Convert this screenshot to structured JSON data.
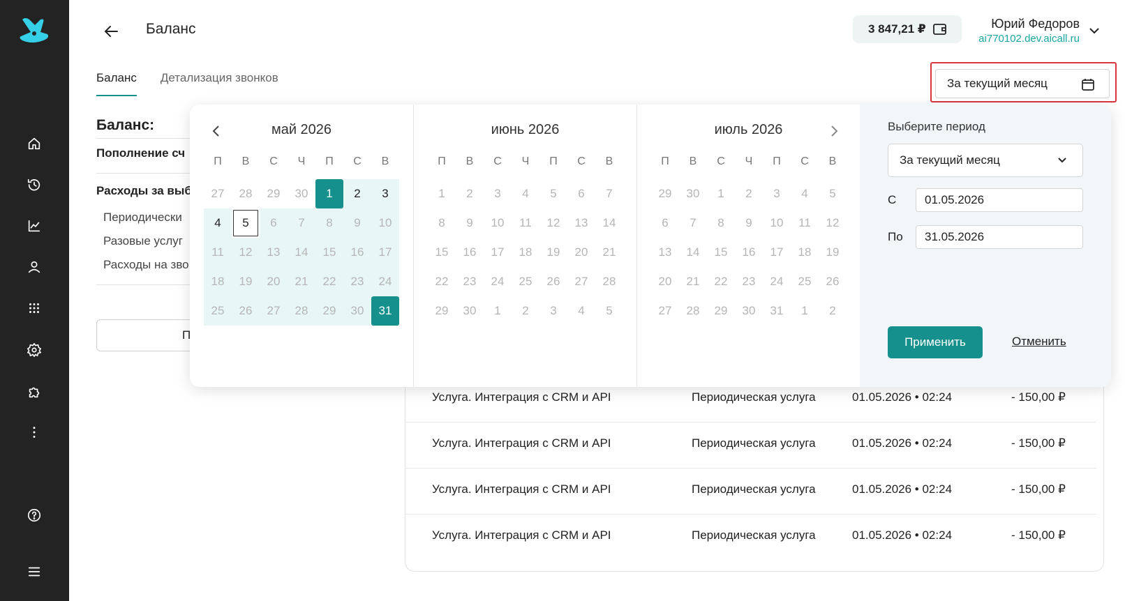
{
  "header": {
    "title": "Баланс",
    "balance": "3 847,21 ₽",
    "user_name": "Юрий Федоров",
    "user_domain": "ai770102.dev.aicall.ru"
  },
  "tabs": [
    {
      "label": "Баланс",
      "active": true
    },
    {
      "label": "Детализация звонков",
      "active": false
    }
  ],
  "period_button": {
    "label": "За текущий месяц"
  },
  "sidebar": {
    "icons": [
      "home-icon",
      "history-icon",
      "analytics-icon",
      "user-icon",
      "dialpad-icon",
      "settings-icon",
      "puzzle-icon",
      "more-icon",
      "help-icon",
      "menu-icon"
    ]
  },
  "left": {
    "title": "Баланс:",
    "topup": "Пополнение сч",
    "expenses": "Расходы за выб",
    "periodic": "Периодически",
    "onetime": "Разовые услуг",
    "calls": "Расходы на зво",
    "button": "П"
  },
  "table": {
    "rows": [
      {
        "service": "Услуга. Интеграция с CRM и API",
        "type": "Периодическая услуга",
        "date": "01.05.2026 • 02:24",
        "amount": "- 150,00 ₽"
      },
      {
        "service": "Услуга. Интеграция с CRM и API",
        "type": "Периодическая услуга",
        "date": "01.05.2026 • 02:24",
        "amount": "- 150,00 ₽"
      },
      {
        "service": "Услуга. Интеграция с CRM и API",
        "type": "Периодическая услуга",
        "date": "01.05.2026 • 02:24",
        "amount": "- 150,00 ₽"
      },
      {
        "service": "Услуга. Интеграция с CRM и API",
        "type": "Периодическая услуга",
        "date": "01.05.2026 • 02:24",
        "amount": "- 150,00 ₽"
      }
    ]
  },
  "calendar": {
    "weekdays": [
      "П",
      "В",
      "С",
      "Ч",
      "П",
      "С",
      "В"
    ],
    "months": [
      {
        "title": "май 2026",
        "first_cur_index": 4,
        "days": [
          27,
          28,
          29,
          30,
          1,
          2,
          3,
          4,
          5,
          6,
          7,
          8,
          9,
          10,
          11,
          12,
          13,
          14,
          15,
          16,
          17,
          18,
          19,
          20,
          21,
          22,
          23,
          24,
          25,
          26,
          27,
          28,
          29,
          30,
          31
        ],
        "cur_count": 31,
        "range": true,
        "today": 5,
        "selected": [
          1,
          31
        ]
      },
      {
        "title": "июнь 2026",
        "first_cur_index": 0,
        "days": [
          1,
          2,
          3,
          4,
          5,
          6,
          7,
          8,
          9,
          10,
          11,
          12,
          13,
          14,
          15,
          16,
          17,
          18,
          19,
          20,
          21,
          22,
          23,
          24,
          25,
          26,
          27,
          28,
          29,
          30,
          1,
          2,
          3,
          4,
          5
        ],
        "cur_count": 30,
        "range": false
      },
      {
        "title": "июль 2026",
        "first_cur_index": 2,
        "days": [
          29,
          30,
          1,
          2,
          3,
          4,
          5,
          6,
          7,
          8,
          9,
          10,
          11,
          12,
          13,
          14,
          15,
          16,
          17,
          18,
          19,
          20,
          21,
          22,
          23,
          24,
          25,
          26,
          27,
          28,
          29,
          30,
          31,
          1,
          2
        ],
        "cur_count": 31,
        "range": false
      }
    ],
    "side": {
      "label": "Выберите период",
      "select_value": "За текущий месяц",
      "from_label": "С",
      "from_value": "01.05.2026",
      "to_label": "По",
      "to_value": "31.05.2026",
      "apply": "Применить",
      "cancel": "Отменить"
    }
  },
  "colors": {
    "accent": "#16908c",
    "sidebar": "#232323",
    "range": "#e8f7f6",
    "highlight": "#d9363e"
  }
}
